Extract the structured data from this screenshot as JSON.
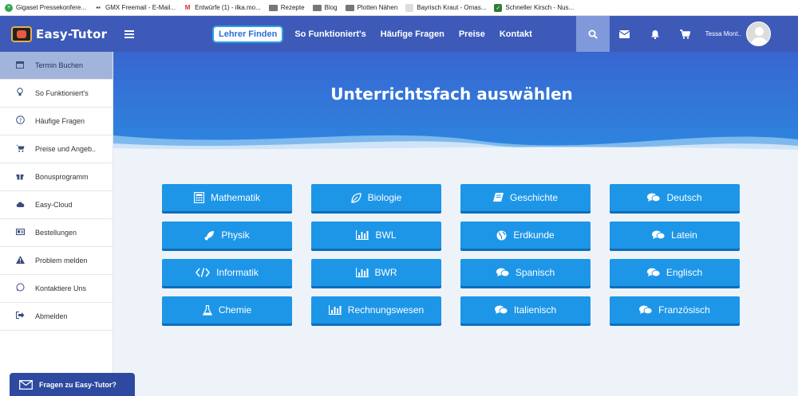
{
  "bookmarks": [
    {
      "label": "Gigaset Pressekonfere...",
      "icon": "gigaset-icon"
    },
    {
      "label": "GMX Freemail - E-Mail...",
      "icon": "gmx-icon"
    },
    {
      "label": "Entwürfe (1) - ilka.mo...",
      "icon": "gmail-icon"
    },
    {
      "label": "Rezepte",
      "icon": "folder-icon"
    },
    {
      "label": "Blog",
      "icon": "folder-icon"
    },
    {
      "label": "Plotten Nähen",
      "icon": "folder-icon"
    },
    {
      "label": "Bayrisch Kraut - Omas...",
      "icon": "page-icon"
    },
    {
      "label": "Schneller Kirsch - Nus...",
      "icon": "page-icon"
    }
  ],
  "header": {
    "logo_text": "Easy-Tutor",
    "nav": [
      "Lehrer Finden",
      "So Funktioniert's",
      "Häufige Fragen",
      "Preise",
      "Kontakt"
    ],
    "user_name": "Tessa Mont.."
  },
  "sidebar": {
    "items": [
      {
        "label": "Termin Buchen",
        "icon": "calendar-icon"
      },
      {
        "label": "So Funktioniert's",
        "icon": "lightbulb-icon"
      },
      {
        "label": "Häufige Fragen",
        "icon": "question-icon"
      },
      {
        "label": "Preise und Angeb..",
        "icon": "cart-icon"
      },
      {
        "label": "Bonusprogramm",
        "icon": "gift-icon"
      },
      {
        "label": "Easy-Cloud",
        "icon": "cloud-icon"
      },
      {
        "label": "Bestellungen",
        "icon": "id-card-icon"
      },
      {
        "label": "Problem melden",
        "icon": "warning-icon"
      },
      {
        "label": "Kontaktiere Uns",
        "icon": "whatsapp-icon"
      },
      {
        "label": "Abmelden",
        "icon": "logout-icon"
      }
    ]
  },
  "main": {
    "title": "Unterrichtsfach auswählen",
    "subjects": [
      {
        "label": "Mathematik",
        "icon": "calculator-icon"
      },
      {
        "label": "Biologie",
        "icon": "leaf-icon"
      },
      {
        "label": "Geschichte",
        "icon": "book-icon"
      },
      {
        "label": "Deutsch",
        "icon": "chat-icon"
      },
      {
        "label": "Physik",
        "icon": "rocket-icon"
      },
      {
        "label": "BWL",
        "icon": "bar-chart-icon"
      },
      {
        "label": "Erdkunde",
        "icon": "globe-icon"
      },
      {
        "label": "Latein",
        "icon": "chat-icon"
      },
      {
        "label": "Informatik",
        "icon": "code-icon"
      },
      {
        "label": "BWR",
        "icon": "bar-chart-icon"
      },
      {
        "label": "Spanisch",
        "icon": "chat-icon"
      },
      {
        "label": "Englisch",
        "icon": "chat-icon"
      },
      {
        "label": "Chemie",
        "icon": "flask-icon"
      },
      {
        "label": "Rechnungswesen",
        "icon": "bar-chart-icon"
      },
      {
        "label": "Italienisch",
        "icon": "chat-icon"
      },
      {
        "label": "Französisch",
        "icon": "chat-icon"
      }
    ]
  },
  "help_button": {
    "label": "Fragen zu Easy-Tutor?"
  },
  "colors": {
    "header_bg": "#3d5ab8",
    "banner_top": "#2f7fdc",
    "subject_button": "#1e96e8",
    "sidebar_active": "#a3b4dc",
    "help_button": "#2d4aa0"
  }
}
